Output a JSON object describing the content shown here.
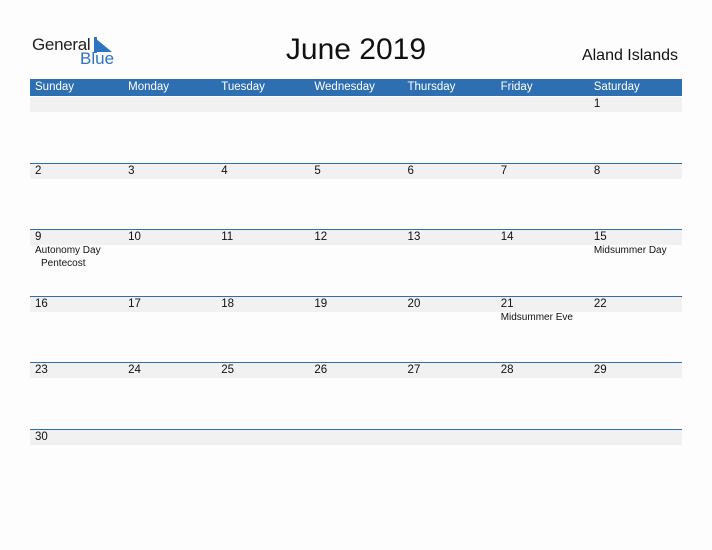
{
  "logo": {
    "line1": "General",
    "line2": "Blue"
  },
  "header": {
    "title": "June 2019",
    "country": "Aland Islands"
  },
  "colors": {
    "accent": "#2e6fb2",
    "strip": "#f1f1f1"
  },
  "weekdays": [
    "Sunday",
    "Monday",
    "Tuesday",
    "Wednesday",
    "Thursday",
    "Friday",
    "Saturday"
  ],
  "weeks": [
    [
      {
        "day": ""
      },
      {
        "day": ""
      },
      {
        "day": ""
      },
      {
        "day": ""
      },
      {
        "day": ""
      },
      {
        "day": ""
      },
      {
        "day": "1"
      }
    ],
    [
      {
        "day": "2"
      },
      {
        "day": "3"
      },
      {
        "day": "4"
      },
      {
        "day": "5"
      },
      {
        "day": "6"
      },
      {
        "day": "7"
      },
      {
        "day": "8"
      }
    ],
    [
      {
        "day": "9",
        "events": [
          "Autonomy Day",
          "Pentecost"
        ]
      },
      {
        "day": "10"
      },
      {
        "day": "11"
      },
      {
        "day": "12"
      },
      {
        "day": "13"
      },
      {
        "day": "14"
      },
      {
        "day": "15",
        "events": [
          "Midsummer Day"
        ]
      }
    ],
    [
      {
        "day": "16"
      },
      {
        "day": "17"
      },
      {
        "day": "18"
      },
      {
        "day": "19"
      },
      {
        "day": "20"
      },
      {
        "day": "21",
        "events": [
          "Midsummer Eve"
        ]
      },
      {
        "day": "22"
      }
    ],
    [
      {
        "day": "23"
      },
      {
        "day": "24"
      },
      {
        "day": "25"
      },
      {
        "day": "26"
      },
      {
        "day": "27"
      },
      {
        "day": "28"
      },
      {
        "day": "29"
      }
    ],
    [
      {
        "day": "30"
      },
      {
        "day": ""
      },
      {
        "day": ""
      },
      {
        "day": ""
      },
      {
        "day": ""
      },
      {
        "day": ""
      },
      {
        "day": ""
      }
    ]
  ]
}
